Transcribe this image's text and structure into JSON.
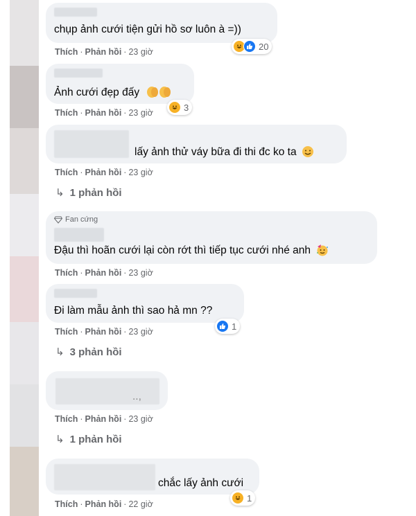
{
  "actions": {
    "like": "Thích",
    "reply": "Phản hồi"
  },
  "comments": [
    {
      "text": "chụp ảnh cưới tiện gửi hồ sơ luôn à =))",
      "time": "23 giờ",
      "reaction_count": "20",
      "reactions": [
        "haha-icon",
        "like-icon"
      ]
    },
    {
      "text": "Ảnh cưới đẹp đấy",
      "emoji": "clap-hands-icon",
      "time": "23 giờ",
      "reaction_count": "3",
      "reactions": [
        "haha-icon"
      ]
    },
    {
      "text": "lấy ảnh thử váy bữa đi thi đc ko ta",
      "emoji": "smile-icon",
      "time": "23 giờ",
      "replies": "1 phản hồi"
    },
    {
      "badge": "Fan cứng",
      "text": "Đậu thì hoãn cưới lại còn rớt thì tiếp tục cưới nhé anh",
      "emoji": "party-face-icon",
      "time": "23 giờ"
    },
    {
      "text": "Đi làm mẫu ảnh thì sao hả mn ??",
      "time": "23 giờ",
      "reaction_count": "1",
      "reactions": [
        "like-icon"
      ],
      "replies": "3 phản hồi"
    },
    {
      "text": "..,",
      "time": "23 giờ",
      "replies": "1 phản hồi"
    },
    {
      "text": "chắc lấy ảnh cưới",
      "time": "22 giờ",
      "reaction_count": "1",
      "reactions": [
        "haha-icon"
      ]
    }
  ],
  "colors": {
    "bubble": "#f0f2f5",
    "meta_text": "#65676b",
    "like_blue": "#1877f2",
    "haha_yellow": "#f7b125"
  }
}
